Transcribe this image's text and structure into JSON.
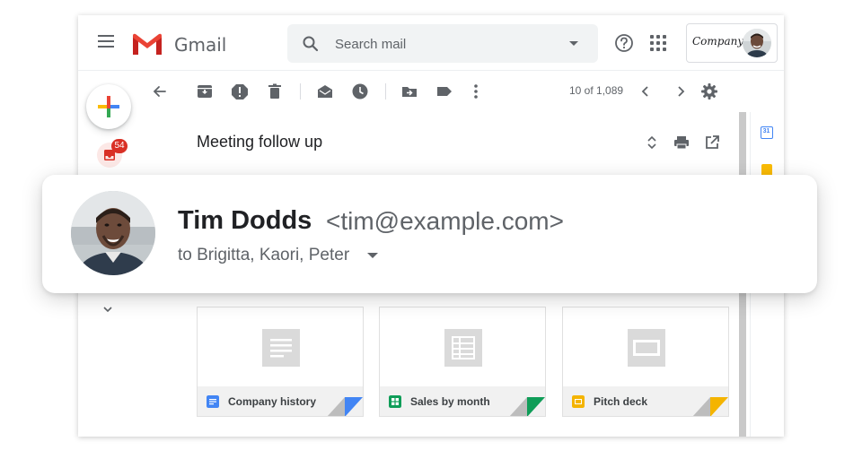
{
  "app": {
    "name": "Gmail"
  },
  "header": {
    "search_placeholder": "Search mail",
    "account_logo_text": "Company"
  },
  "sidebar": {
    "inbox_badge": "54"
  },
  "toolbar": {
    "page_count": "10 of 1,089"
  },
  "message": {
    "subject": "Meeting follow up",
    "sender_name": "Tim Dodds",
    "sender_email": "<tim@example.com>",
    "recipients": "to Brigitta, Kaori, Peter"
  },
  "side_panel": {
    "calendar_day": "31"
  },
  "attachments": [
    {
      "name": "Company history",
      "type": "docs",
      "color": "#4285f4"
    },
    {
      "name": "Sales by month",
      "type": "sheets",
      "color": "#0f9d58"
    },
    {
      "name": "Pitch deck",
      "type": "slides",
      "color": "#f4b400"
    }
  ],
  "colors": {
    "gmail_red": "#ea4335",
    "badge_red": "#d93025",
    "icon_gray": "#5f6368",
    "docs_blue": "#4285f4",
    "sheets_green": "#0f9d58",
    "slides_yellow": "#f4b400"
  }
}
